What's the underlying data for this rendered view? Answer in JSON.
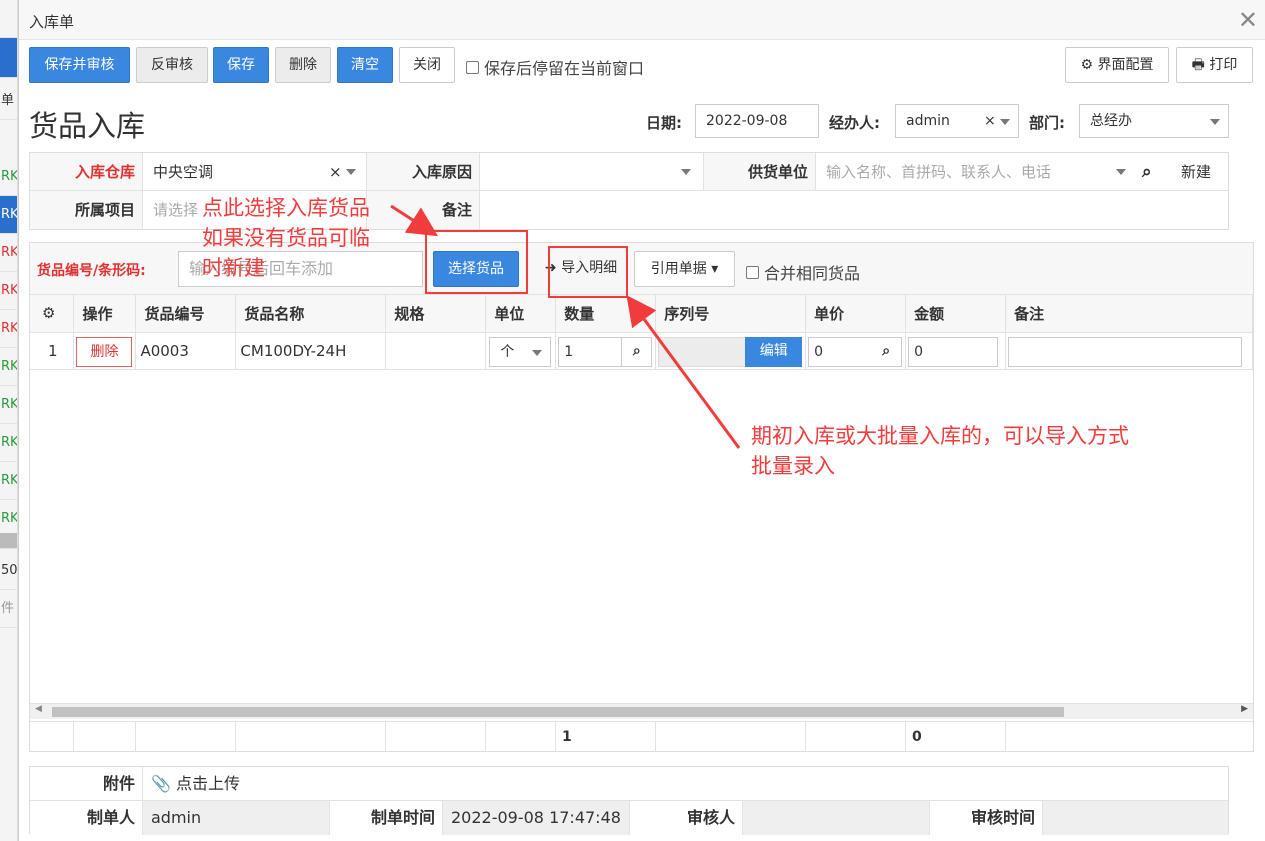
{
  "background_list": {
    "rows": [
      "",
      "单",
      "RK",
      "RK",
      "RK",
      "RK",
      "RK",
      "RK",
      "RK",
      "RK",
      "RK",
      "RK",
      "",
      "50",
      "件",
      ""
    ]
  },
  "dialog": {
    "title": "入库单"
  },
  "toolbar": {
    "save_approve": "保存并审核",
    "unapprove": "反审核",
    "save": "保存",
    "delete": "删除",
    "clear": "清空",
    "close": "关闭",
    "stay_label": "保存后停留在当前窗口",
    "layout_config": "界面配置",
    "print": "打印"
  },
  "header": {
    "title": "货品入库",
    "date_label": "日期:",
    "date_value": "2022-09-08",
    "handler_label": "经办人:",
    "handler_value": "admin",
    "dept_label": "部门:",
    "dept_value": "总经办"
  },
  "form": {
    "warehouse_label": "入库仓库",
    "warehouse_value": "中央空调",
    "reason_label": "入库原因",
    "reason_value": "",
    "supplier_label": "供货单位",
    "supplier_placeholder": "输入名称、首拼码、联系人、电话",
    "new_label": "新建",
    "project_label": "所属项目",
    "project_placeholder": "请选择",
    "remark_label": "备注",
    "remark_value": ""
  },
  "goods_bar": {
    "code_label": "货品编号/条形码:",
    "code_placeholder": "输入编号后回车添加",
    "select_goods": "选择货品",
    "import_detail": "导入明细",
    "ref_doc": "引用单据",
    "merge_label": "合并相同货品"
  },
  "grid": {
    "headers": [
      "操作",
      "货品编号",
      "货品名称",
      "规格",
      "单位",
      "数量",
      "序列号",
      "单价",
      "金额",
      "备注"
    ],
    "rows": [
      {
        "index": "1",
        "action": "删除",
        "code": "A0003",
        "name": "CM100DY-24H",
        "spec": "",
        "unit": "个",
        "qty": "1",
        "serial_btn": "编辑",
        "price": "0",
        "amount": "0",
        "remark": ""
      }
    ],
    "totals": {
      "qty": "1",
      "amount": "0"
    }
  },
  "info": {
    "attachment_label": "附件",
    "upload_label": "点击上传",
    "creator_label": "制单人",
    "creator_value": "admin",
    "create_time_label": "制单时间",
    "create_time_value": "2022-09-08 17:47:48",
    "approver_label": "审核人",
    "approver_value": "",
    "approve_time_label": "审核时间",
    "approve_time_value": ""
  },
  "annotations": {
    "select_hint_1": "点此选择入库货品",
    "select_hint_2": "如果没有货品可临",
    "select_hint_3": "时新建",
    "import_hint_1": "期初入库或大批量入库的，可以导入方式",
    "import_hint_2": "批量录入",
    "color": "#f03c3c"
  },
  "colors": {
    "primary": "#3a87e0",
    "required": "#e03030"
  }
}
